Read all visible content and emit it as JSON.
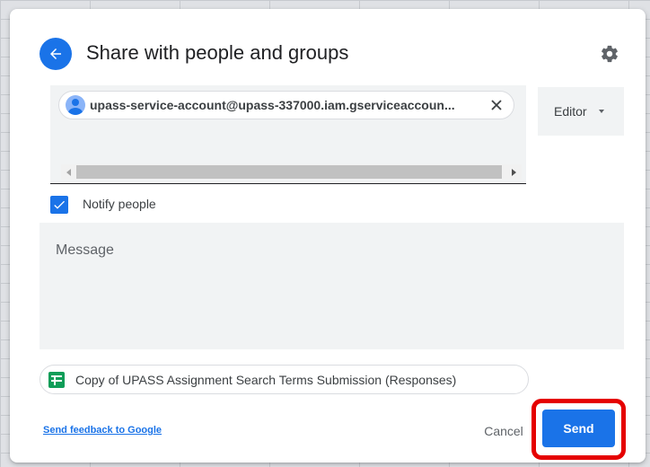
{
  "dialog": {
    "title": "Share with people and groups",
    "back_icon": "arrow-back-icon",
    "settings_icon": "gear-icon"
  },
  "recipients": {
    "chips": [
      {
        "email": "upass-service-account@upass-337000.iam.gserviceaccoun...",
        "avatar_icon": "person-avatar-icon",
        "remove_icon": "close-icon"
      }
    ]
  },
  "role": {
    "selected": "Editor",
    "caret_icon": "caret-down-icon"
  },
  "notify": {
    "label": "Notify people",
    "checked": true
  },
  "message": {
    "placeholder": "Message",
    "value": ""
  },
  "file": {
    "name": "Copy of UPASS Assignment Search Terms Submission (Responses)",
    "icon": "google-sheets-icon"
  },
  "footer": {
    "feedback_link": "Send feedback to Google",
    "cancel_label": "Cancel",
    "send_label": "Send"
  },
  "colors": {
    "accent": "#1a73e8",
    "highlight": "#e50000"
  }
}
